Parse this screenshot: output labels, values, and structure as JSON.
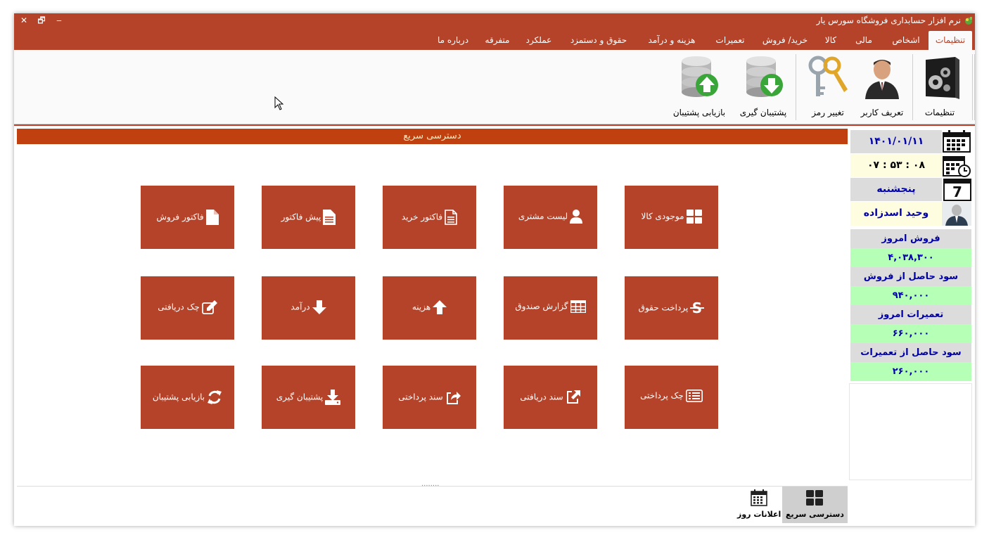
{
  "window": {
    "title": "نرم افزار حسابداری فروشگاه سورس یار",
    "controls": {
      "close": "✕",
      "restore": "🗗",
      "minimize": "‒"
    }
  },
  "menu": {
    "tabs": [
      {
        "label": "تنظیمات",
        "active": true
      },
      {
        "label": "اشخاص"
      },
      {
        "label": "مالی"
      },
      {
        "label": "کالا"
      },
      {
        "label": "خرید/ فروش"
      },
      {
        "label": "تعمیرات"
      },
      {
        "label": "هزینه و درآمد"
      },
      {
        "label": "حقوق و دستمزد"
      },
      {
        "label": "عملکرد"
      },
      {
        "label": "متفرقه"
      },
      {
        "label": "درباره ما"
      }
    ]
  },
  "ribbon": {
    "buttons": [
      {
        "label": "تنظیمات",
        "icon": "gears-box-icon"
      },
      {
        "label": "تعریف کاربر",
        "icon": "user-icon"
      },
      {
        "label": "تغییر رمز",
        "icon": "keys-icon"
      },
      {
        "label": "پشتیبان گیری",
        "icon": "database-download-icon"
      },
      {
        "label": "بازیابی پشتیبان",
        "icon": "database-upload-icon"
      }
    ]
  },
  "quick_access": {
    "title": "دسترسی سریع",
    "tiles": [
      {
        "label": "موجودی کالا",
        "icon": "grid-icon"
      },
      {
        "label": "لیست مشتری",
        "icon": "person-icon"
      },
      {
        "label": "فاکتور خرید",
        "icon": "document-lines-icon"
      },
      {
        "label": "پیش فاکتور",
        "icon": "document-filled-icon"
      },
      {
        "label": "فاکتور فروش",
        "icon": "file-icon"
      },
      {
        "label": "پرداخت حقوق",
        "icon": "currency-icon"
      },
      {
        "label": "گزارش صندوق",
        "icon": "table-icon"
      },
      {
        "label": "هزینه",
        "icon": "arrow-up-icon"
      },
      {
        "label": "درآمد",
        "icon": "arrow-down-icon"
      },
      {
        "label": "چک دریافتی",
        "icon": "edit-icon"
      },
      {
        "label": "چک پرداختی",
        "icon": "list-icon"
      },
      {
        "label": "سند دریافتی",
        "icon": "external-link-icon"
      },
      {
        "label": "سند پرداختی",
        "icon": "share-icon"
      },
      {
        "label": "پشتیبان گیری",
        "icon": "download-icon"
      },
      {
        "label": "بازیابی پشتیبان",
        "icon": "refresh-icon"
      }
    ],
    "splitter": "........"
  },
  "bottom_tabs": [
    {
      "label": "دسترسی سریع",
      "icon": "grid-icon",
      "active": true
    },
    {
      "label": "اعلانات روز",
      "icon": "calendar-icon"
    }
  ],
  "side": {
    "date": "۱۴۰۱/۰۱/۱۱",
    "time": "۰۸ : ۵۳ : ۰۷",
    "weekday": "پنجشنبه",
    "calendar_day": "7",
    "user": "وحید اسدزاده",
    "stats": [
      {
        "label": "فروش امروز",
        "value": "۴,۰۳۸,۳۰۰"
      },
      {
        "label": "سود حاصل از فروش",
        "value": "۹۴۰,۰۰۰"
      },
      {
        "label": "تعمیرات امروز",
        "value": "۶۶۰,۰۰۰"
      },
      {
        "label": "سود حاصل از تعمیرات",
        "value": "۲۶۰,۰۰۰"
      }
    ]
  },
  "colors": {
    "accent": "#b5432a",
    "header": "#c0400f",
    "stat_label_bg": "#dcdcdc",
    "stat_value_bg": "#b6ffb6",
    "stat_text": "#0000a8"
  }
}
